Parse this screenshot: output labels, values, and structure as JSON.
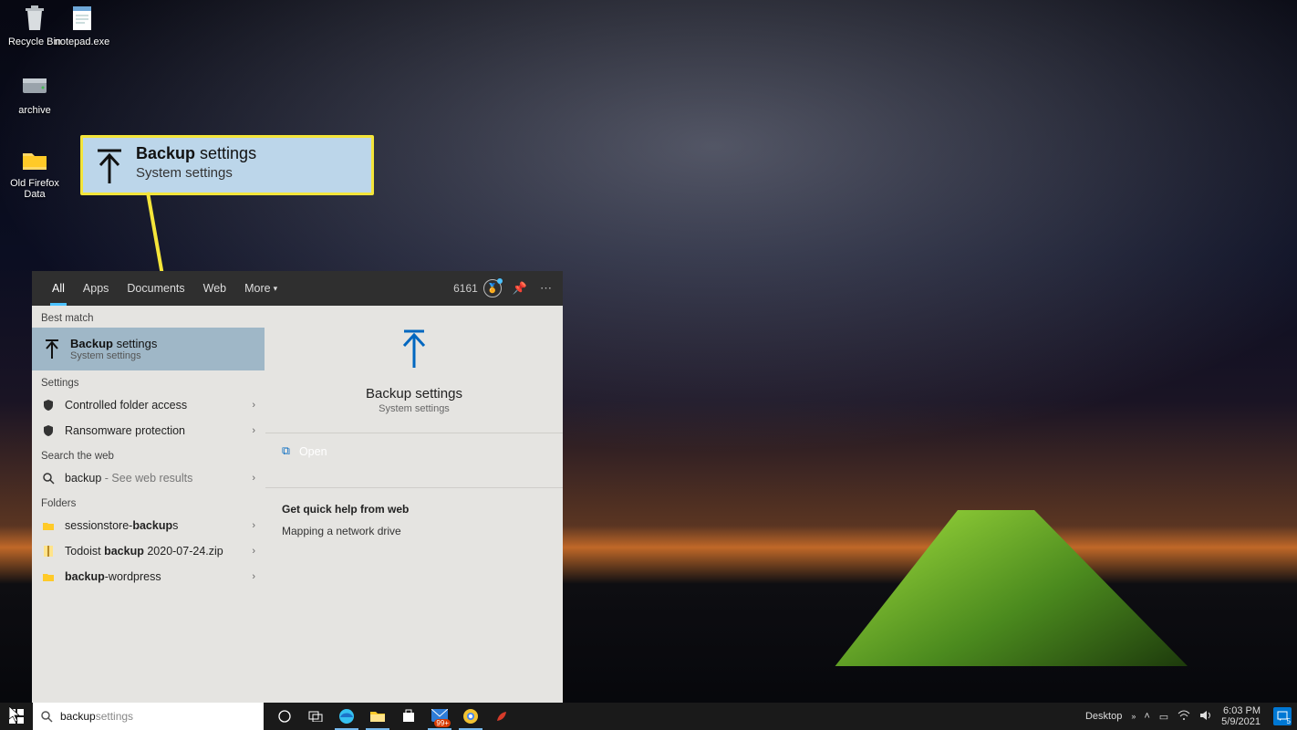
{
  "desktop": {
    "icons": [
      {
        "label": "Recycle Bin"
      },
      {
        "label": "notepad.exe"
      },
      {
        "label": "archive"
      },
      {
        "label": "Old Firefox Data"
      }
    ]
  },
  "callout": {
    "title_bold": "Backup",
    "title_rest": " settings",
    "subtitle": "System settings"
  },
  "search_panel": {
    "tabs": [
      "All",
      "Apps",
      "Documents",
      "Web",
      "More"
    ],
    "points": "6161",
    "sections": {
      "best_match_label": "Best match",
      "best_match": {
        "title_bold": "Backup",
        "title_rest": " settings",
        "subtitle": "System settings"
      },
      "settings_label": "Settings",
      "settings_items": [
        {
          "label": "Controlled folder access"
        },
        {
          "label": "Ransomware protection"
        }
      ],
      "web_label": "Search the web",
      "web_item": {
        "term": "backup",
        "suffix": " - See web results"
      },
      "folders_label": "Folders",
      "folders_items": [
        {
          "pre": "sessionstore-",
          "bold": "backup",
          "post": "s"
        },
        {
          "pre": "Todoist ",
          "bold": "backup",
          "post": " 2020-07-24.zip"
        },
        {
          "pre": "",
          "bold": "backup",
          "post": "-wordpress"
        }
      ]
    },
    "right": {
      "title": "Backup settings",
      "subtitle": "System settings",
      "open_label": "Open",
      "help_heading": "Get quick help from web",
      "help_link": "Mapping a network drive"
    }
  },
  "taskbar": {
    "search_typed": "backup",
    "search_ghost": " settings",
    "tray": {
      "desktop_label": "Desktop",
      "time": "6:03 PM",
      "date": "5/9/2021",
      "badge": "99+"
    }
  }
}
